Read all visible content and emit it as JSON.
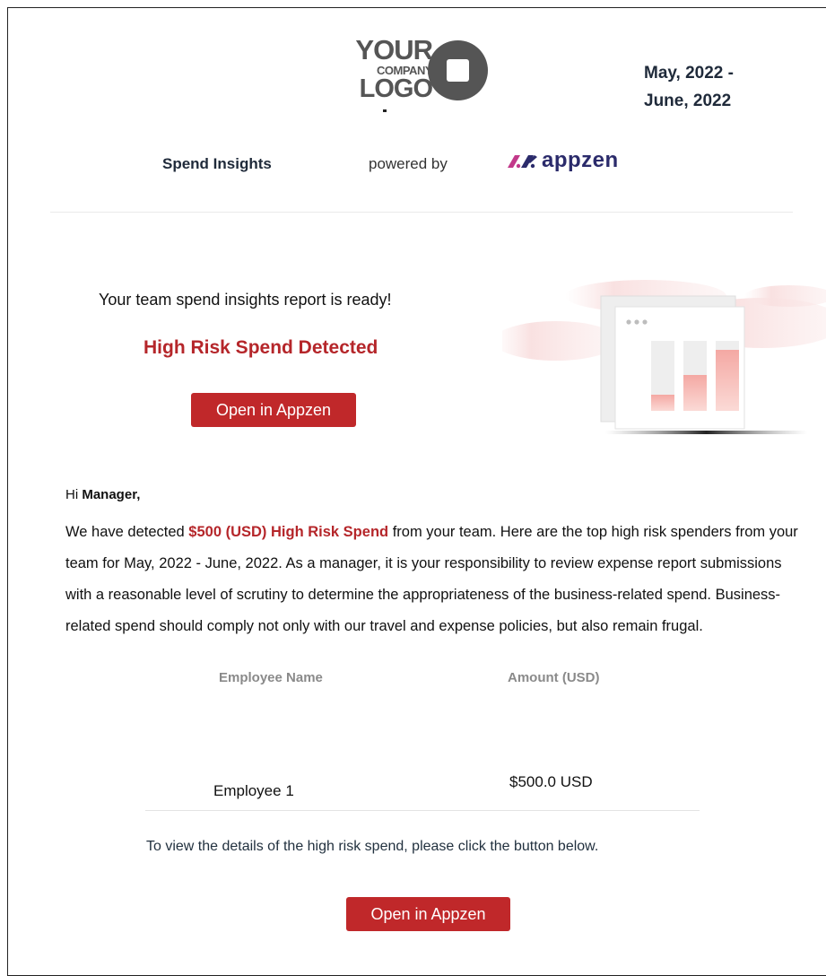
{
  "header": {
    "logo": {
      "line1": "YOUR",
      "line2": "COMPANY",
      "line3": "LOGO",
      "icon": "company-logo-icon"
    },
    "date_range_line1": "May, 2022 -",
    "date_range_line2": "June, 2022",
    "spend_insights": "Spend Insights",
    "powered_by": "powered by",
    "appzen": {
      "wordmark": "appzen",
      "icon": "appzen-mark-icon"
    }
  },
  "hero": {
    "ready_text": "Your team spend insights report is ready!",
    "alert_text": "High Risk Spend Detected",
    "open_button": "Open in Appzen",
    "illustration_icon": "bar-chart-window-icon"
  },
  "message": {
    "greeting_prefix": "Hi ",
    "greeting_name": "Manager,",
    "para_start": "We have detected ",
    "para_highlight": "$500 (USD) High Risk Spend",
    "para_rest": " from your team. Here are the top high risk spenders from your team for May, 2022 - June, 2022. As a manager, it is your responsibility to review expense report submissions with a reasonable level of scrutiny to determine the appropriateness of the business-related spend. Business-related spend should comply not only with our travel and expense policies, but also remain frugal."
  },
  "table": {
    "columns": [
      "Employee Name",
      "Amount (USD)"
    ],
    "rows": [
      {
        "name": "Employee 1",
        "amount": "$500.0 USD"
      }
    ]
  },
  "footer": {
    "details_note": "To view the details of the high risk spend, please click the button below.",
    "open_button": "Open in Appzen"
  },
  "colors": {
    "accent_red": "#c0282a",
    "alert_red": "#b5262a",
    "heading_navy": "#1f2a3a",
    "appzen_navy": "#2b2b6b",
    "appzen_magenta": "#c2398a"
  }
}
